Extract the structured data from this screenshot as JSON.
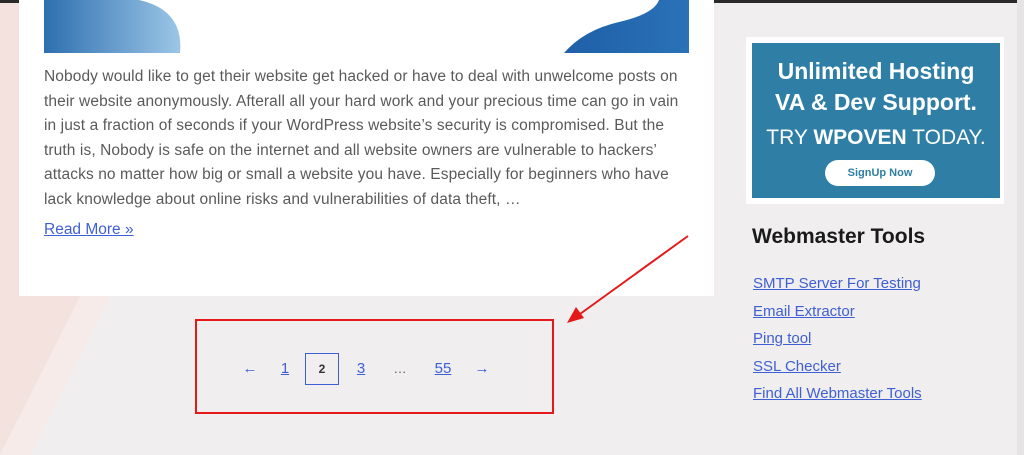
{
  "post": {
    "excerpt": "Nobody would like to get their website get hacked or have to deal with unwelcome posts on their website anonymously. Afterall all your hard work and your precious time can go in vain in just a fraction of seconds if your WordPress website’s security is compromised. But the truth is, Nobody is safe on the internet and all website owners are vulnerable to hackers’ attacks no matter how big or small a website you have. Especially for beginners who have lack knowledge about online risks and vulnerabilities of data theft, …",
    "read_more": "Read More »"
  },
  "pagination": {
    "prev": "←",
    "pages": [
      "1",
      "2",
      "3"
    ],
    "current": "2",
    "dots": "…",
    "last": "55",
    "next": "→"
  },
  "sidebar": {
    "ad": {
      "headline_line1": "Unlimited Hosting",
      "headline_line2": "VA & Dev Support.",
      "try_prefix": "TRY ",
      "try_brand": "WPOVEN",
      "try_suffix": " TODAY.",
      "signup": "SignUp Now"
    },
    "widget_title": "Webmaster Tools",
    "tools": [
      "SMTP Server For Testing",
      "Email Extractor",
      "Ping tool",
      "SSL Checker",
      "Find All Webmaster Tools"
    ]
  },
  "colors": {
    "link": "#3f5fd4",
    "highlight": "#e41a1a",
    "ad_background": "#2e7ea6"
  }
}
